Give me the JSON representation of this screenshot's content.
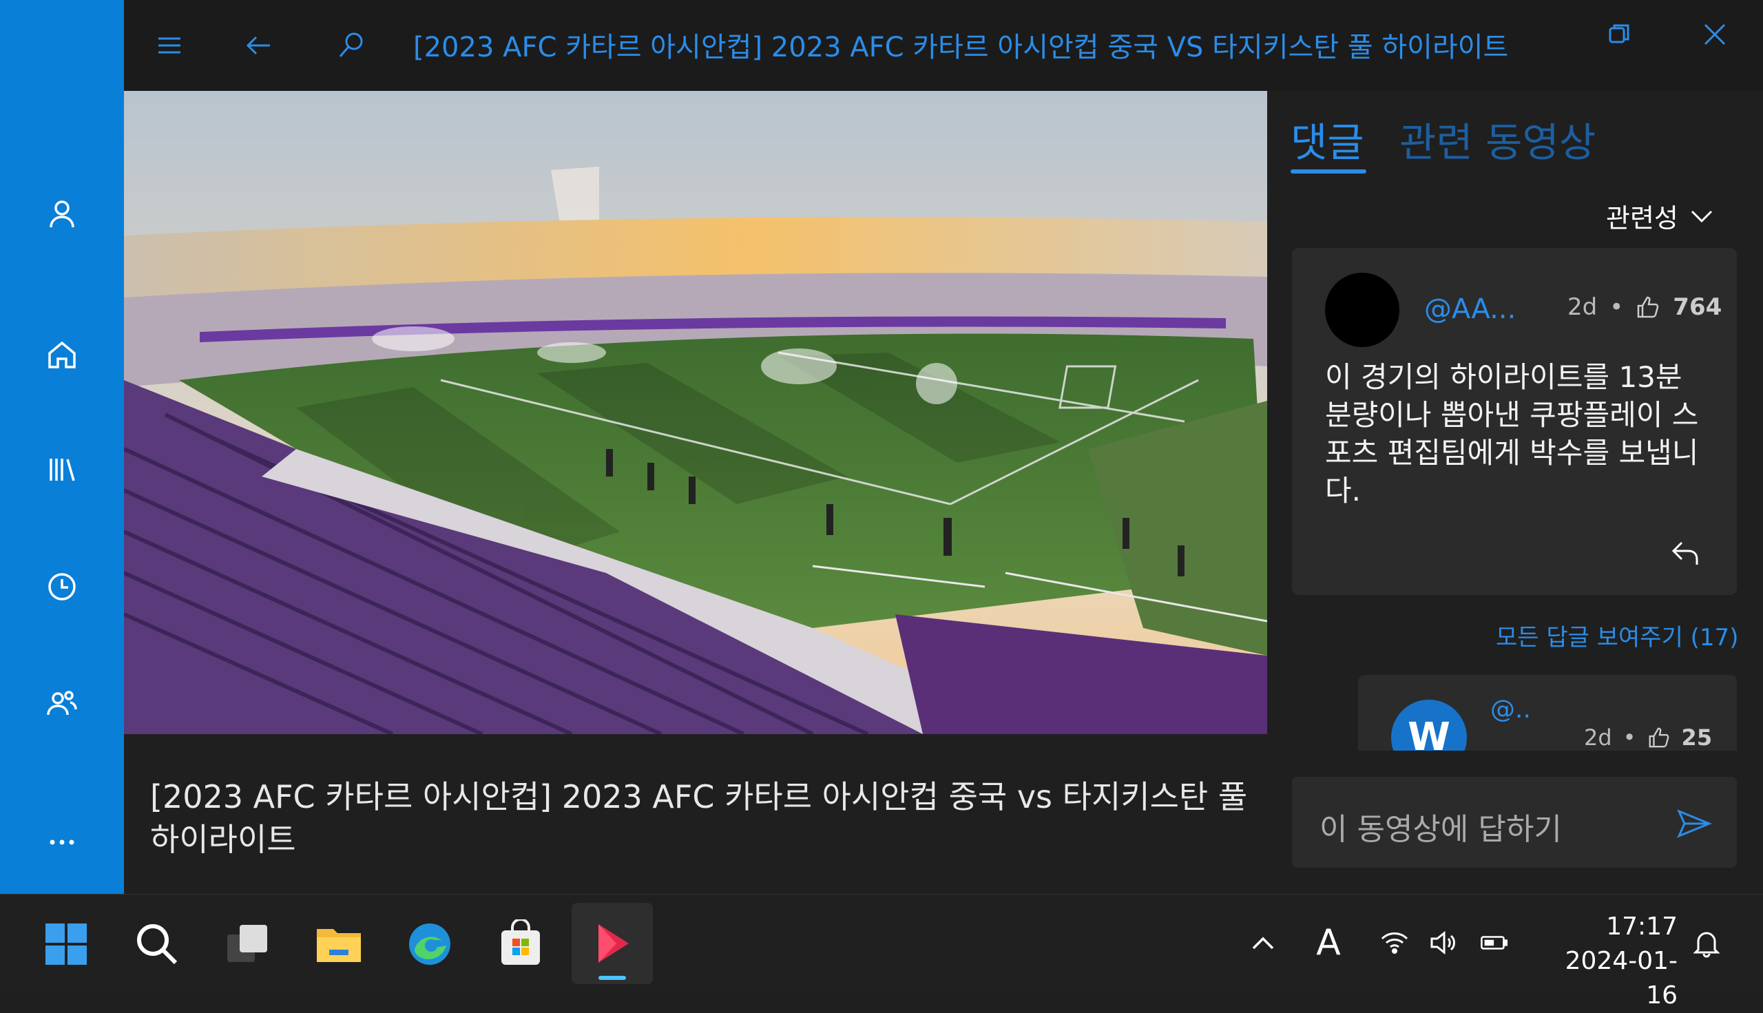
{
  "window": {
    "title": "[2023 AFC 카타르 아시안컵] 2023 AFC 카타르 아시안컵 중국 VS 타지키스탄 풀 하이라이트"
  },
  "video": {
    "caption": "[2023 AFC 카타르 아시안컵] 2023 AFC 카타르 아시안컵 중국 vs 타지키스탄 풀 하이라이트"
  },
  "tabs": [
    {
      "label": "댓글",
      "active": true
    },
    {
      "label": "관련 동영상",
      "active": false
    }
  ],
  "sort": {
    "label": "관련성"
  },
  "comments": [
    {
      "user": "@AA...",
      "age": "2d",
      "likes": "764",
      "text": "이 경기의 하이라이트를 13분 분량이나 뽑아낸 쿠팡플레이 스포츠 편집팀에게 박수를 보냅니다."
    }
  ],
  "all_replies_label": "모든 답글 보여주기 (17)",
  "replies": [
    {
      "avatar_letter": "W",
      "user": "@..",
      "age": "2d",
      "likes": "25"
    }
  ],
  "reply_box": {
    "placeholder": "이 동영상에 답하기"
  },
  "taskbar": {
    "time": "17:17",
    "date": "2024-01-16",
    "ime": "A"
  },
  "colors": {
    "accent": "#2a8dea",
    "rail": "#0a7fd8"
  }
}
